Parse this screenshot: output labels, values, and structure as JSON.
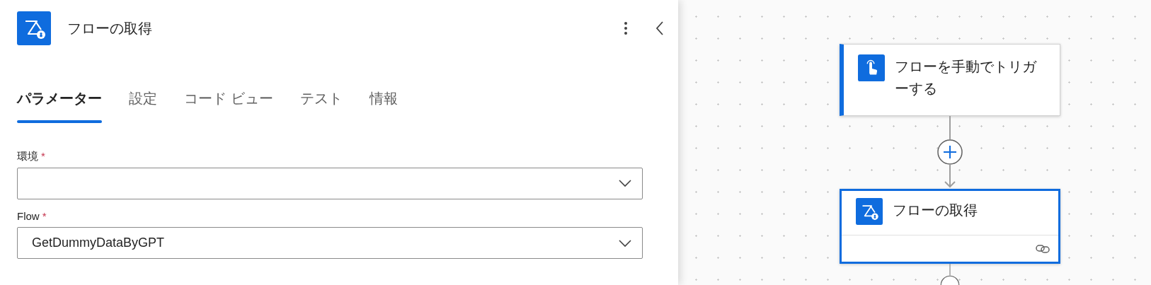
{
  "panel": {
    "title": "フローの取得",
    "tabs": [
      {
        "label": "パラメーター",
        "selected": true
      },
      {
        "label": "設定",
        "selected": false
      },
      {
        "label": "コード ビュー",
        "selected": false
      },
      {
        "label": "テスト",
        "selected": false
      },
      {
        "label": "情報",
        "selected": false
      }
    ],
    "fields": [
      {
        "label": "環境",
        "required_mark": "*"
      },
      {
        "label": "Flow",
        "required_mark": "*",
        "value": "GetDummyDataByGPT"
      }
    ]
  },
  "canvas": {
    "nodes": [
      {
        "kind": "trigger",
        "title": "フローを手動でトリガーする",
        "selected": false
      },
      {
        "kind": "action",
        "title": "フローの取得",
        "selected": true
      }
    ]
  }
}
